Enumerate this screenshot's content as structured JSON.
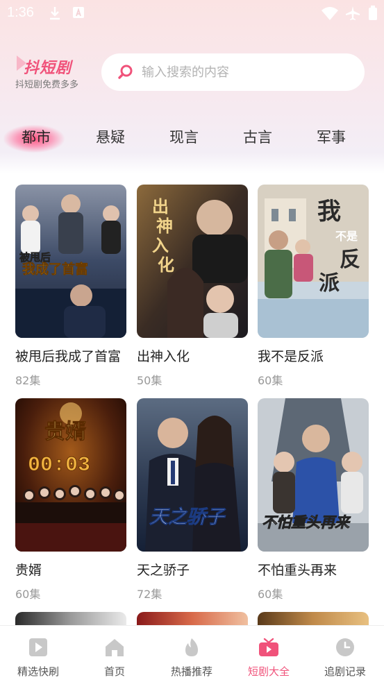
{
  "status_bar": {
    "time": "1:36",
    "icons": [
      "download-icon",
      "a-badge-icon",
      "wifi-icon",
      "airplane-icon",
      "battery-icon"
    ]
  },
  "header": {
    "logo_title": "抖短剧",
    "logo_subtitle": "抖短剧免费多多",
    "search_placeholder": "输入搜索的内容"
  },
  "tabs": [
    {
      "label": "都市",
      "active": true
    },
    {
      "label": "悬疑",
      "active": false
    },
    {
      "label": "现言",
      "active": false
    },
    {
      "label": "古言",
      "active": false
    },
    {
      "label": "军事",
      "active": false
    }
  ],
  "dramas": [
    {
      "title": "被甩后我成了首富",
      "episodes": "82集",
      "poster_text": "被甩后我成了首富"
    },
    {
      "title": "出神入化",
      "episodes": "50集",
      "poster_text": "出神入化"
    },
    {
      "title": "我不是反派",
      "episodes": "60集",
      "poster_text": "我不是反派"
    },
    {
      "title": "贵婿",
      "episodes": "60集",
      "poster_text": "贵婿",
      "poster_subtext": "00:03"
    },
    {
      "title": "天之骄子",
      "episodes": "72集",
      "poster_text": "天之骄子"
    },
    {
      "title": "不怕重头再来",
      "episodes": "60集",
      "poster_text": "不怕重头再来"
    }
  ],
  "bottom_nav": [
    {
      "label": "精选快刷",
      "icon": "play-square-icon",
      "active": false
    },
    {
      "label": "首页",
      "icon": "home-icon",
      "active": false
    },
    {
      "label": "热播推荐",
      "icon": "flame-icon",
      "active": false
    },
    {
      "label": "短剧大全",
      "icon": "tv-icon",
      "active": true
    },
    {
      "label": "追剧记录",
      "icon": "clock-icon",
      "active": false
    }
  ],
  "colors": {
    "accent": "#f0527a",
    "inactive_icon": "#c8c8c8"
  }
}
